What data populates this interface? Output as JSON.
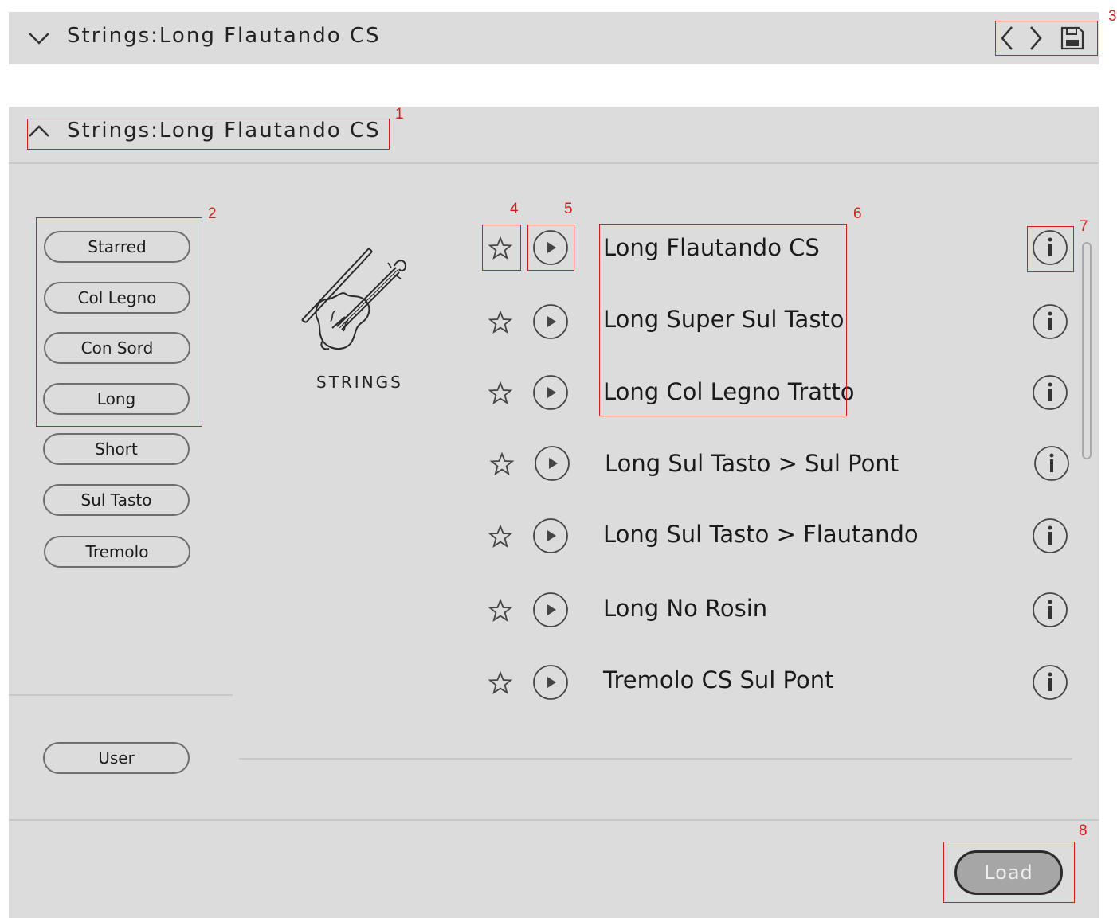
{
  "top_bar": {
    "title": "Strings:Long Flautando CS"
  },
  "panel": {
    "title": "Strings:Long Flautando CS",
    "category_label": "STRINGS"
  },
  "filters": [
    {
      "label": "Starred"
    },
    {
      "label": "Col Legno"
    },
    {
      "label": "Con Sord"
    },
    {
      "label": "Long"
    },
    {
      "label": "Short"
    },
    {
      "label": "Sul Tasto"
    },
    {
      "label": "Tremolo"
    }
  ],
  "user_button": {
    "label": "User"
  },
  "presets": [
    {
      "name": "Long Flautando CS"
    },
    {
      "name": "Long Super Sul Tasto"
    },
    {
      "name": "Long Col Legno Tratto"
    },
    {
      "name": "Long Sul Tasto > Sul Pont"
    },
    {
      "name": "Long Sul Tasto > Flautando"
    },
    {
      "name": "Long No Rosin"
    },
    {
      "name": "Tremolo CS Sul Pont"
    }
  ],
  "load_button": {
    "label": "Load"
  },
  "annotations": [
    "1",
    "2",
    "3",
    "4",
    "5",
    "6",
    "7",
    "8"
  ],
  "icons": {
    "collapse": "chevron-down-icon",
    "expand": "chevron-up-icon",
    "prev": "chevron-left-icon",
    "next": "chevron-right-icon",
    "save": "save-disk-icon",
    "star": "star-icon",
    "play": "play-icon",
    "info": "info-icon",
    "category": "violin-icon"
  },
  "colors": {
    "panel_bg": "#dcdcdc",
    "annotation_red": "#d81b1b",
    "load_bg": "#a6a6a6"
  }
}
